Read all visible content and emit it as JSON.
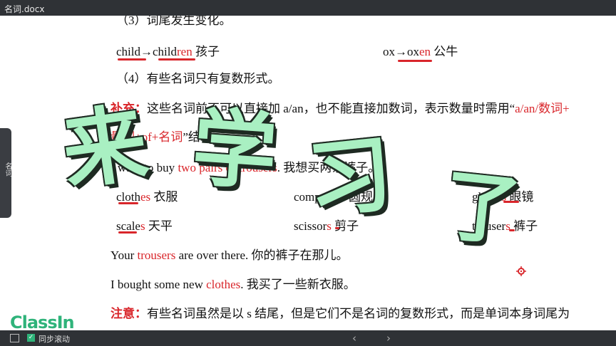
{
  "window": {
    "title": "名词.docx"
  },
  "side_tab": {
    "label": "名词"
  },
  "doc": {
    "h3": "（3）词尾发生变化。",
    "ex1_a": "child→child",
    "ex1_b": "ren",
    "ex1_c": " 孩子",
    "ex2_a": "ox→ox",
    "ex2_b": "en",
    "ex2_c": " 公牛",
    "h4": "（4）有些名词只有复数形式。",
    "sup_label": "补充：",
    "sup_text": "这些名词前不可以直接加 a/an，也不能直接加数词，表示数量时需用“",
    "sup_red": "a/an/数词+",
    "sup2_red": "量词+of+名词",
    "sup2_text": "”结构。",
    "s1_a": "I want to buy ",
    "s1_b": "two pairs of trousers",
    "s1_c": ". 我想买两条裤子。",
    "w1_a": "cloth",
    "w1_b": "es",
    "w1_c": " 衣服",
    "w2_a": "compass",
    "w2_b": "es",
    "w2_c": " 圆规",
    "w3_a": "glass",
    "w3_b": "es",
    "w3_c": " 眼镜",
    "w4_a": "scale",
    "w4_b": "s",
    "w4_c": " 天平",
    "w5_a": "scissor",
    "w5_b": "s",
    "w5_c": " 剪子",
    "w6_a": "trouser",
    "w6_b": "s",
    "w6_c": " 裤子",
    "s2_a": "Your ",
    "s2_b": "trousers",
    "s2_c": " are over there. 你的裤子在那儿。",
    "s3_a": "I bought some new ",
    "s3_b": "clothes",
    "s3_c": ". 我买了一些新衣服。",
    "note_label": "注意：",
    "note_text": "有些名词虽然是以 s 结尾，但是它们不是名词的复数形式，而是单词本身词尾为"
  },
  "overlay": {
    "c1": "来",
    "c2": "学",
    "c3": "习",
    "c4": "了"
  },
  "logo": {
    "text": "ClassIn"
  },
  "bottombar": {
    "sync_label": "同步滚动",
    "prev": "‹",
    "next": "›"
  },
  "colors": {
    "accent_red": "#d9262b",
    "overlay_green": "#a9f0c2",
    "brand_green": "#2fb37a"
  }
}
